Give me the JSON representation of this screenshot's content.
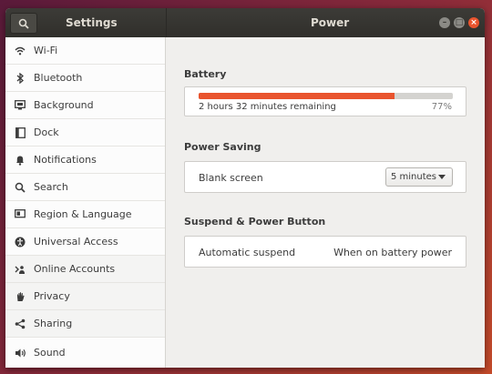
{
  "titlebar": {
    "left_title": "Settings",
    "center_title": "Power"
  },
  "sidebar": {
    "items": [
      {
        "label": "Wi-Fi",
        "icon": "wifi-icon"
      },
      {
        "label": "Bluetooth",
        "icon": "bluetooth-icon"
      },
      {
        "label": "Background",
        "icon": "background-icon"
      },
      {
        "label": "Dock",
        "icon": "dock-icon"
      },
      {
        "label": "Notifications",
        "icon": "bell-icon"
      },
      {
        "label": "Search",
        "icon": "search-icon"
      },
      {
        "label": "Region & Language",
        "icon": "flag-icon"
      },
      {
        "label": "Universal Access",
        "icon": "accessibility-icon"
      },
      {
        "label": "Online Accounts",
        "icon": "online-accounts-icon"
      },
      {
        "label": "Privacy",
        "icon": "hand-icon"
      },
      {
        "label": "Sharing",
        "icon": "share-icon"
      },
      {
        "label": "Sound",
        "icon": "speaker-icon"
      }
    ]
  },
  "battery": {
    "section_title": "Battery",
    "remaining_text": "2 hours 32 minutes remaining",
    "percent_text": "77%",
    "level": 0.77
  },
  "power_saving": {
    "section_title": "Power Saving",
    "blank_screen_label": "Blank screen",
    "blank_screen_value": "5 minutes"
  },
  "suspend": {
    "section_title": "Suspend & Power Button",
    "automatic_suspend_label": "Automatic suspend",
    "automatic_suspend_value": "When on battery power"
  },
  "colors": {
    "accent": "#e9542e",
    "titlebar": "#3c3b37"
  }
}
